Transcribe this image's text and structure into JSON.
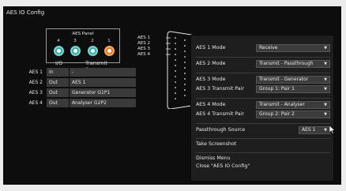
{
  "window": {
    "title": "AES IO Config"
  },
  "panel": {
    "title": "AES Panel",
    "ports": [
      {
        "number": "4",
        "color": "teal"
      },
      {
        "number": "3",
        "color": "teal"
      },
      {
        "number": "2",
        "color": "teal"
      },
      {
        "number": "1",
        "color": "orange"
      }
    ]
  },
  "table": {
    "headers": {
      "io": "I/O",
      "source": "Transmit Source"
    },
    "rows": [
      {
        "label": "AES 1",
        "io": "In",
        "source": "-"
      },
      {
        "label": "AES 2",
        "io": "Out",
        "source": "AES 1"
      },
      {
        "label": "AES 3",
        "io": "Out",
        "source": "Generator G1P1"
      },
      {
        "label": "AES 4",
        "io": "Out",
        "source": "Analyser G2P2"
      }
    ]
  },
  "connector": {
    "labels": [
      "AES 1",
      "AES 2",
      "AES 3",
      "AES 4"
    ]
  },
  "menu": {
    "rows": [
      {
        "label": "AES 1 Mode",
        "value": "Receive"
      },
      {
        "label": "AES 2 Mode",
        "value": "Transmit - Passthrough"
      },
      {
        "label": "AES 3 Mode",
        "value": "Transmit - Generator"
      },
      {
        "label": "AES 3 Transmit Pair",
        "value": "Group 1: Pair 1"
      },
      {
        "label": "AES 4 Mode",
        "value": "Transmit - Analyser"
      },
      {
        "label": "AES 4 Transmit Pair",
        "value": "Group 2: Pair 2"
      }
    ],
    "passthrough": {
      "label": "Passthrough Source",
      "value": "AES 1"
    },
    "screenshot": "Take Screenshot",
    "dismiss": "Dismiss Menu",
    "close": "Close \"AES IO Config\""
  },
  "colors": {
    "teal": "#3aa9a7",
    "orange": "#e8751a",
    "menu_bg": "#1e1e1e",
    "dropdown_bg": "#3c3c3c"
  },
  "icons": [
    "dropdown-arrow-icon",
    "mouse-cursor-icon",
    "d-sub-connector-icon"
  ]
}
